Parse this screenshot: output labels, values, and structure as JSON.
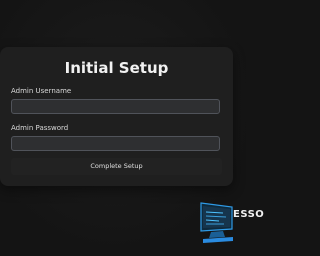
{
  "card": {
    "title": "Initial Setup",
    "username_label": "Admin Username",
    "username_value": "",
    "password_label": "Admin Password",
    "password_value": "",
    "submit_label": "Complete Setup"
  },
  "logo": {
    "text": "ESSO",
    "icon": "monitor-icon"
  },
  "colors": {
    "background": "#141414",
    "card": "#1f1f1f",
    "field": "#2e2f31",
    "accent": "#1e88e5"
  }
}
